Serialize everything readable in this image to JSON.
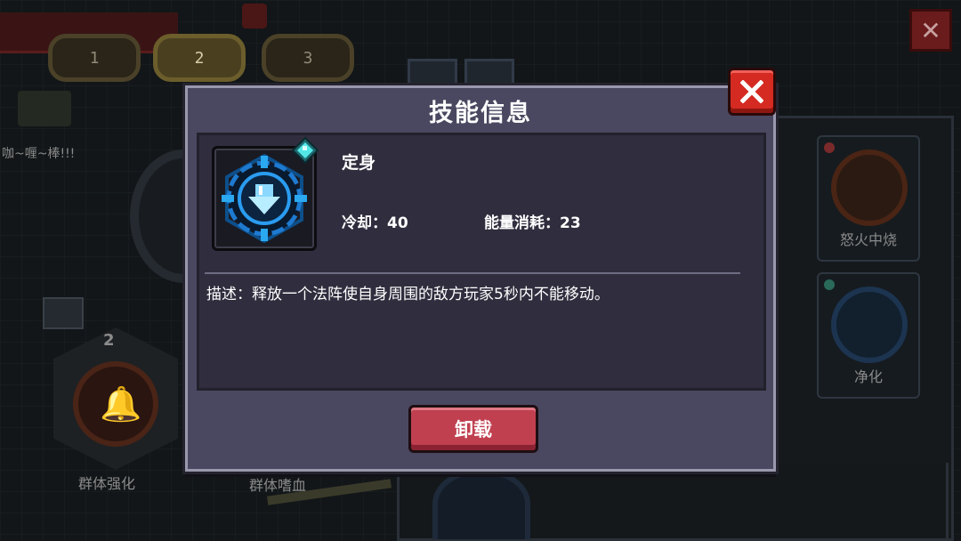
{
  "background": {
    "slot_tabs": [
      "1",
      "2",
      "3"
    ],
    "active_slot": "2",
    "chat_text": "咖~喱~棒!!!",
    "skill_level": "2",
    "left_skill_label": "群体强化",
    "middle_skill_label": "群体嗜血",
    "right_skills": [
      {
        "label": "怒火中烧"
      },
      {
        "label": "净化"
      }
    ],
    "close_glyph": "✕"
  },
  "dialog": {
    "title": "技能信息",
    "skill": {
      "name": "定身",
      "icon": "immobilize-rune-icon",
      "cooldown_label": "冷却：",
      "cooldown_value": "40",
      "energy_label": "能量消耗：",
      "energy_value": "23"
    },
    "description": "描述：释放一个法阵使自身周围的敌方玩家5秒内不能移动。",
    "unload_label": "卸载",
    "close_glyph": "✕"
  },
  "colors": {
    "dialog_bg": "#4a4860",
    "inner_bg": "#302e3e",
    "close_red": "#d42a22",
    "unload_red": "#c04050",
    "skill_blue": "#1e8ee0",
    "gem_cyan": "#52e8e8"
  }
}
